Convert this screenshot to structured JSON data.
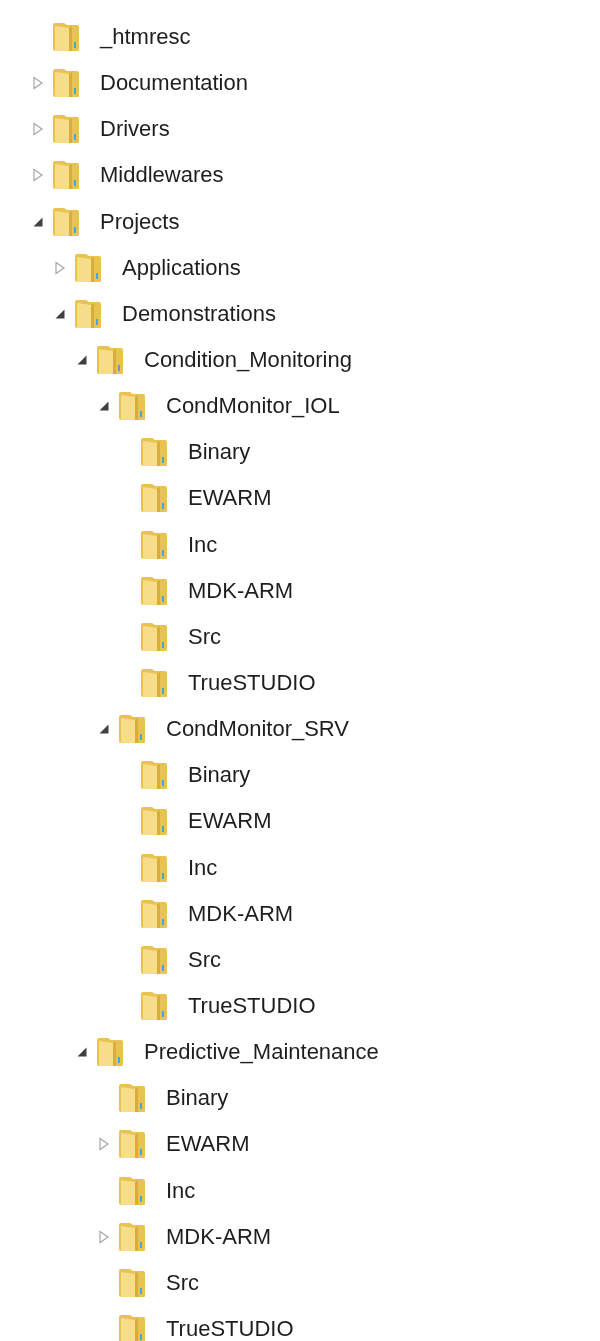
{
  "tree": [
    {
      "label": "_htmresc"
    },
    {
      "label": "Documentation",
      "expanded": false
    },
    {
      "label": "Drivers",
      "expanded": false
    },
    {
      "label": "Middlewares",
      "expanded": false
    },
    {
      "label": "Projects",
      "expanded": true,
      "children": [
        {
          "label": "Applications",
          "expanded": false
        },
        {
          "label": "Demonstrations",
          "expanded": true,
          "children": [
            {
              "label": "Condition_Monitoring",
              "expanded": true,
              "children": [
                {
                  "label": "CondMonitor_IOL",
                  "expanded": true,
                  "children": [
                    {
                      "label": "Binary"
                    },
                    {
                      "label": "EWARM"
                    },
                    {
                      "label": "Inc"
                    },
                    {
                      "label": "MDK-ARM"
                    },
                    {
                      "label": "Src"
                    },
                    {
                      "label": "TrueSTUDIO"
                    }
                  ]
                },
                {
                  "label": "CondMonitor_SRV",
                  "expanded": true,
                  "children": [
                    {
                      "label": "Binary"
                    },
                    {
                      "label": "EWARM"
                    },
                    {
                      "label": "Inc"
                    },
                    {
                      "label": "MDK-ARM"
                    },
                    {
                      "label": "Src"
                    },
                    {
                      "label": "TrueSTUDIO"
                    }
                  ]
                }
              ]
            },
            {
              "label": "Predictive_Maintenance",
              "expanded": true,
              "children": [
                {
                  "label": "Binary"
                },
                {
                  "label": "EWARM",
                  "expanded": false
                },
                {
                  "label": "Inc"
                },
                {
                  "label": "MDK-ARM",
                  "expanded": false
                },
                {
                  "label": "Src"
                },
                {
                  "label": "TrueSTUDIO"
                }
              ]
            }
          ]
        }
      ]
    }
  ]
}
